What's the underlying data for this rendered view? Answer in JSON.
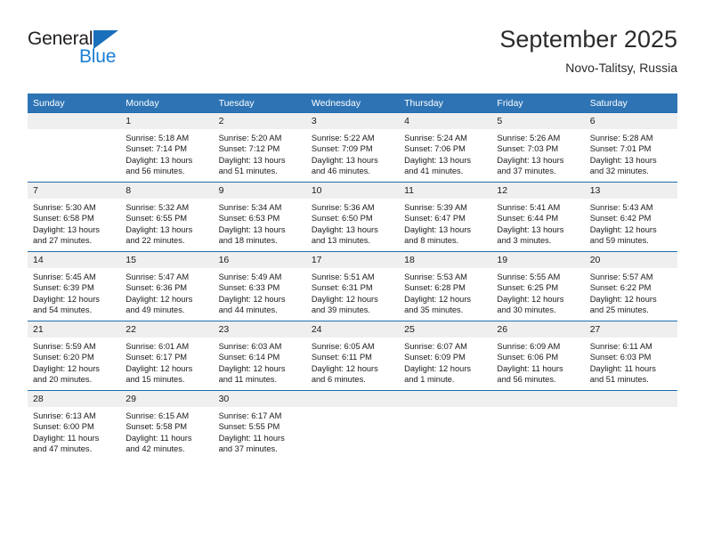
{
  "brand": {
    "name_part1": "General",
    "name_part2": "Blue",
    "triangle_icon": "triangle-icon"
  },
  "header": {
    "title": "September 2025",
    "location": "Novo-Talitsy, Russia"
  },
  "colors": {
    "header_blue": "#2e74b5",
    "separator_blue": "#1f6cb0",
    "daynum_background": "#efefef",
    "logo_blue": "#1a7fd4",
    "text": "#1a1a1a"
  },
  "calendar": {
    "weekday_headers": [
      "Sunday",
      "Monday",
      "Tuesday",
      "Wednesday",
      "Thursday",
      "Friday",
      "Saturday"
    ],
    "weeks": [
      [
        {
          "day": "",
          "sunrise": "",
          "sunset": "",
          "daylight_line1": "",
          "daylight_line2": "",
          "empty": true
        },
        {
          "day": "1",
          "sunrise": "Sunrise: 5:18 AM",
          "sunset": "Sunset: 7:14 PM",
          "daylight_line1": "Daylight: 13 hours",
          "daylight_line2": "and 56 minutes."
        },
        {
          "day": "2",
          "sunrise": "Sunrise: 5:20 AM",
          "sunset": "Sunset: 7:12 PM",
          "daylight_line1": "Daylight: 13 hours",
          "daylight_line2": "and 51 minutes."
        },
        {
          "day": "3",
          "sunrise": "Sunrise: 5:22 AM",
          "sunset": "Sunset: 7:09 PM",
          "daylight_line1": "Daylight: 13 hours",
          "daylight_line2": "and 46 minutes."
        },
        {
          "day": "4",
          "sunrise": "Sunrise: 5:24 AM",
          "sunset": "Sunset: 7:06 PM",
          "daylight_line1": "Daylight: 13 hours",
          "daylight_line2": "and 41 minutes."
        },
        {
          "day": "5",
          "sunrise": "Sunrise: 5:26 AM",
          "sunset": "Sunset: 7:03 PM",
          "daylight_line1": "Daylight: 13 hours",
          "daylight_line2": "and 37 minutes."
        },
        {
          "day": "6",
          "sunrise": "Sunrise: 5:28 AM",
          "sunset": "Sunset: 7:01 PM",
          "daylight_line1": "Daylight: 13 hours",
          "daylight_line2": "and 32 minutes."
        }
      ],
      [
        {
          "day": "7",
          "sunrise": "Sunrise: 5:30 AM",
          "sunset": "Sunset: 6:58 PM",
          "daylight_line1": "Daylight: 13 hours",
          "daylight_line2": "and 27 minutes."
        },
        {
          "day": "8",
          "sunrise": "Sunrise: 5:32 AM",
          "sunset": "Sunset: 6:55 PM",
          "daylight_line1": "Daylight: 13 hours",
          "daylight_line2": "and 22 minutes."
        },
        {
          "day": "9",
          "sunrise": "Sunrise: 5:34 AM",
          "sunset": "Sunset: 6:53 PM",
          "daylight_line1": "Daylight: 13 hours",
          "daylight_line2": "and 18 minutes."
        },
        {
          "day": "10",
          "sunrise": "Sunrise: 5:36 AM",
          "sunset": "Sunset: 6:50 PM",
          "daylight_line1": "Daylight: 13 hours",
          "daylight_line2": "and 13 minutes."
        },
        {
          "day": "11",
          "sunrise": "Sunrise: 5:39 AM",
          "sunset": "Sunset: 6:47 PM",
          "daylight_line1": "Daylight: 13 hours",
          "daylight_line2": "and 8 minutes."
        },
        {
          "day": "12",
          "sunrise": "Sunrise: 5:41 AM",
          "sunset": "Sunset: 6:44 PM",
          "daylight_line1": "Daylight: 13 hours",
          "daylight_line2": "and 3 minutes."
        },
        {
          "day": "13",
          "sunrise": "Sunrise: 5:43 AM",
          "sunset": "Sunset: 6:42 PM",
          "daylight_line1": "Daylight: 12 hours",
          "daylight_line2": "and 59 minutes."
        }
      ],
      [
        {
          "day": "14",
          "sunrise": "Sunrise: 5:45 AM",
          "sunset": "Sunset: 6:39 PM",
          "daylight_line1": "Daylight: 12 hours",
          "daylight_line2": "and 54 minutes."
        },
        {
          "day": "15",
          "sunrise": "Sunrise: 5:47 AM",
          "sunset": "Sunset: 6:36 PM",
          "daylight_line1": "Daylight: 12 hours",
          "daylight_line2": "and 49 minutes."
        },
        {
          "day": "16",
          "sunrise": "Sunrise: 5:49 AM",
          "sunset": "Sunset: 6:33 PM",
          "daylight_line1": "Daylight: 12 hours",
          "daylight_line2": "and 44 minutes."
        },
        {
          "day": "17",
          "sunrise": "Sunrise: 5:51 AM",
          "sunset": "Sunset: 6:31 PM",
          "daylight_line1": "Daylight: 12 hours",
          "daylight_line2": "and 39 minutes."
        },
        {
          "day": "18",
          "sunrise": "Sunrise: 5:53 AM",
          "sunset": "Sunset: 6:28 PM",
          "daylight_line1": "Daylight: 12 hours",
          "daylight_line2": "and 35 minutes."
        },
        {
          "day": "19",
          "sunrise": "Sunrise: 5:55 AM",
          "sunset": "Sunset: 6:25 PM",
          "daylight_line1": "Daylight: 12 hours",
          "daylight_line2": "and 30 minutes."
        },
        {
          "day": "20",
          "sunrise": "Sunrise: 5:57 AM",
          "sunset": "Sunset: 6:22 PM",
          "daylight_line1": "Daylight: 12 hours",
          "daylight_line2": "and 25 minutes."
        }
      ],
      [
        {
          "day": "21",
          "sunrise": "Sunrise: 5:59 AM",
          "sunset": "Sunset: 6:20 PM",
          "daylight_line1": "Daylight: 12 hours",
          "daylight_line2": "and 20 minutes."
        },
        {
          "day": "22",
          "sunrise": "Sunrise: 6:01 AM",
          "sunset": "Sunset: 6:17 PM",
          "daylight_line1": "Daylight: 12 hours",
          "daylight_line2": "and 15 minutes."
        },
        {
          "day": "23",
          "sunrise": "Sunrise: 6:03 AM",
          "sunset": "Sunset: 6:14 PM",
          "daylight_line1": "Daylight: 12 hours",
          "daylight_line2": "and 11 minutes."
        },
        {
          "day": "24",
          "sunrise": "Sunrise: 6:05 AM",
          "sunset": "Sunset: 6:11 PM",
          "daylight_line1": "Daylight: 12 hours",
          "daylight_line2": "and 6 minutes."
        },
        {
          "day": "25",
          "sunrise": "Sunrise: 6:07 AM",
          "sunset": "Sunset: 6:09 PM",
          "daylight_line1": "Daylight: 12 hours",
          "daylight_line2": "and 1 minute."
        },
        {
          "day": "26",
          "sunrise": "Sunrise: 6:09 AM",
          "sunset": "Sunset: 6:06 PM",
          "daylight_line1": "Daylight: 11 hours",
          "daylight_line2": "and 56 minutes."
        },
        {
          "day": "27",
          "sunrise": "Sunrise: 6:11 AM",
          "sunset": "Sunset: 6:03 PM",
          "daylight_line1": "Daylight: 11 hours",
          "daylight_line2": "and 51 minutes."
        }
      ],
      [
        {
          "day": "28",
          "sunrise": "Sunrise: 6:13 AM",
          "sunset": "Sunset: 6:00 PM",
          "daylight_line1": "Daylight: 11 hours",
          "daylight_line2": "and 47 minutes."
        },
        {
          "day": "29",
          "sunrise": "Sunrise: 6:15 AM",
          "sunset": "Sunset: 5:58 PM",
          "daylight_line1": "Daylight: 11 hours",
          "daylight_line2": "and 42 minutes."
        },
        {
          "day": "30",
          "sunrise": "Sunrise: 6:17 AM",
          "sunset": "Sunset: 5:55 PM",
          "daylight_line1": "Daylight: 11 hours",
          "daylight_line2": "and 37 minutes."
        },
        {
          "day": "",
          "sunrise": "",
          "sunset": "",
          "daylight_line1": "",
          "daylight_line2": "",
          "empty": true
        },
        {
          "day": "",
          "sunrise": "",
          "sunset": "",
          "daylight_line1": "",
          "daylight_line2": "",
          "empty": true
        },
        {
          "day": "",
          "sunrise": "",
          "sunset": "",
          "daylight_line1": "",
          "daylight_line2": "",
          "empty": true
        },
        {
          "day": "",
          "sunrise": "",
          "sunset": "",
          "daylight_line1": "",
          "daylight_line2": "",
          "empty": true
        }
      ]
    ]
  }
}
